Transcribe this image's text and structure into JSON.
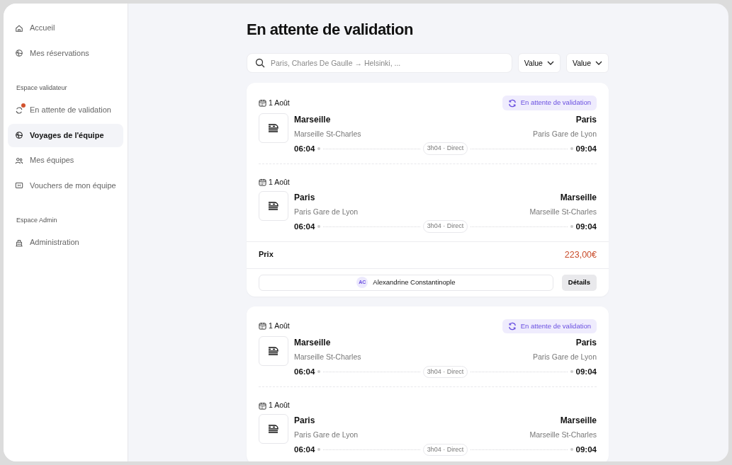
{
  "sidebar": {
    "groups": [
      {
        "items": [
          {
            "label": "Accueil",
            "kind": "home",
            "selected": false,
            "notification": false
          },
          {
            "label": "Mes réservations",
            "kind": "globe",
            "selected": false,
            "notification": false
          }
        ]
      },
      {
        "heading": "Espace validateur",
        "items": [
          {
            "label": "En attente de validation",
            "kind": "sync",
            "selected": false,
            "notification": true
          },
          {
            "label": "Voyages de l'équipe",
            "kind": "globe",
            "selected": true,
            "notification": false
          },
          {
            "label": "Mes équipes",
            "kind": "team",
            "selected": false,
            "notification": false
          },
          {
            "label": "Vouchers de mon équipe",
            "kind": "ticket",
            "selected": false,
            "notification": false
          }
        ]
      },
      {
        "heading": "Espace Admin",
        "items": [
          {
            "label": "Administration",
            "kind": "building",
            "selected": false,
            "notification": false
          }
        ]
      }
    ]
  },
  "page_title": "En attente de validation",
  "search": {
    "placeholder": "Paris, Charles De Gaulle → Helsinki, ..."
  },
  "filters": [
    {
      "label": "Value"
    },
    {
      "label": "Value"
    }
  ],
  "cards": [
    {
      "trips": [
        {
          "date": "1 Août",
          "status": "En attente de validation",
          "from_city": "Marseille",
          "from_station": "Marseille St-Charles",
          "dep_time": "06:04",
          "duration": "3h04 · Direct",
          "to_city": "Paris",
          "to_station": "Paris Gare de Lyon",
          "arr_time": "09:04"
        },
        {
          "date": "1 Août",
          "from_city": "Paris",
          "from_station": "Paris Gare de Lyon",
          "dep_time": "06:04",
          "duration": "3h04 · Direct",
          "to_city": "Marseille",
          "to_station": "Marseille St-Charles",
          "arr_time": "09:04"
        }
      ],
      "price_label": "Prix",
      "price": "223,00€",
      "traveller": {
        "initials": "AC",
        "name": "Alexandrine Constantinople"
      },
      "details_button": "Détails"
    },
    {
      "trips": [
        {
          "date": "1 Août",
          "status": "En attente de validation",
          "from_city": "Marseille",
          "from_station": "Marseille St-Charles",
          "dep_time": "06:04",
          "duration": "3h04 · Direct",
          "to_city": "Paris",
          "to_station": "Paris Gare de Lyon",
          "arr_time": "09:04"
        },
        {
          "date": "1 Août",
          "from_city": "Paris",
          "from_station": "Paris Gare de Lyon",
          "dep_time": "06:04",
          "duration": "3h04 · Direct",
          "to_city": "Marseille",
          "to_station": "Marseille St-Charles",
          "arr_time": "09:04"
        }
      ]
    }
  ]
}
